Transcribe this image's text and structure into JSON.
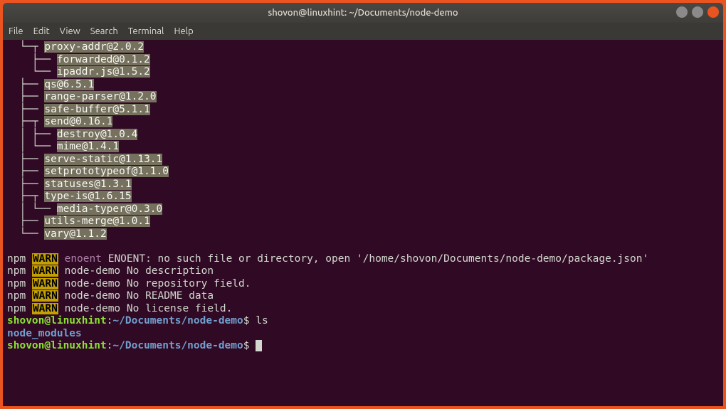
{
  "title": "shovon@linuxhint: ~/Documents/node-demo",
  "menu": [
    "File",
    "Edit",
    "View",
    "Search",
    "Terminal",
    "Help"
  ],
  "tree": [
    {
      "indent": 0,
      "branch": "└─┬ ",
      "pkg": "proxy-addr@2.0.2"
    },
    {
      "indent": 1,
      "branch": "├── ",
      "pkg": "forwarded@0.1.2"
    },
    {
      "indent": 1,
      "branch": "└── ",
      "pkg": "ipaddr.js@1.5.2"
    },
    {
      "indent": 0,
      "branch": "├── ",
      "pkg": "qs@6.5.1",
      "siblingBefore": false
    },
    {
      "indent": 0,
      "branch": "├── ",
      "pkg": "range-parser@1.2.0"
    },
    {
      "indent": 0,
      "branch": "├── ",
      "pkg": "safe-buffer@5.1.1"
    },
    {
      "indent": 0,
      "branch": "├─┬ ",
      "pkg": "send@0.16.1"
    },
    {
      "indent": 1,
      "branch": "├── ",
      "pkg": "destroy@1.0.4",
      "siblingBefore": true
    },
    {
      "indent": 1,
      "branch": "└── ",
      "pkg": "mime@1.4.1",
      "siblingBefore": true
    },
    {
      "indent": 0,
      "branch": "├── ",
      "pkg": "serve-static@1.13.1"
    },
    {
      "indent": 0,
      "branch": "├── ",
      "pkg": "setprototypeof@1.1.0"
    },
    {
      "indent": 0,
      "branch": "├── ",
      "pkg": "statuses@1.3.1"
    },
    {
      "indent": 0,
      "branch": "├─┬ ",
      "pkg": "type-is@1.6.15"
    },
    {
      "indent": 1,
      "branch": "└── ",
      "pkg": "media-typer@0.3.0",
      "siblingBefore": true
    },
    {
      "indent": 0,
      "branch": "├── ",
      "pkg": "utils-merge@1.0.1"
    },
    {
      "indent": 0,
      "branch": "└── ",
      "pkg": "vary@1.1.2"
    }
  ],
  "warnings": [
    {
      "label": "enoent",
      "msg": "ENOENT: no such file or directory, open '/home/shovon/Documents/node-demo/package.json'"
    },
    {
      "label": "",
      "msg": "node-demo No description"
    },
    {
      "label": "",
      "msg": "node-demo No repository field."
    },
    {
      "label": "",
      "msg": "node-demo No README data"
    },
    {
      "label": "",
      "msg": "node-demo No license field."
    }
  ],
  "prompt1": {
    "user": "shovon@linuxhint",
    "path": "~/Documents/node-demo",
    "cmd": "ls"
  },
  "ls_output": "node_modules",
  "prompt2": {
    "user": "shovon@linuxhint",
    "path": "~/Documents/node-demo",
    "cmd": ""
  },
  "npm_label": "npm",
  "warn_label": "WARN"
}
